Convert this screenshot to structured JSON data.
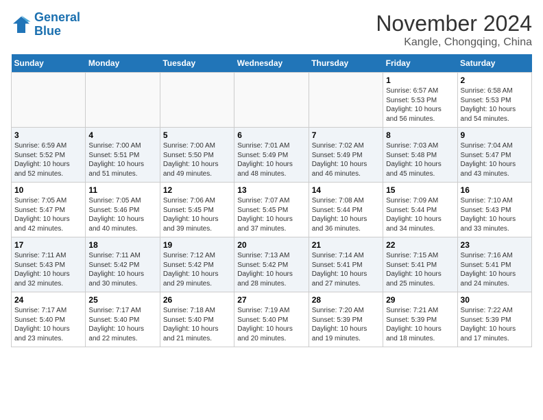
{
  "header": {
    "logo_line1": "General",
    "logo_line2": "Blue",
    "title": "November 2024",
    "subtitle": "Kangle, Chongqing, China"
  },
  "weekdays": [
    "Sunday",
    "Monday",
    "Tuesday",
    "Wednesday",
    "Thursday",
    "Friday",
    "Saturday"
  ],
  "weeks": [
    [
      {
        "num": "",
        "info": ""
      },
      {
        "num": "",
        "info": ""
      },
      {
        "num": "",
        "info": ""
      },
      {
        "num": "",
        "info": ""
      },
      {
        "num": "",
        "info": ""
      },
      {
        "num": "1",
        "info": "Sunrise: 6:57 AM\nSunset: 5:53 PM\nDaylight: 10 hours\nand 56 minutes."
      },
      {
        "num": "2",
        "info": "Sunrise: 6:58 AM\nSunset: 5:53 PM\nDaylight: 10 hours\nand 54 minutes."
      }
    ],
    [
      {
        "num": "3",
        "info": "Sunrise: 6:59 AM\nSunset: 5:52 PM\nDaylight: 10 hours\nand 52 minutes."
      },
      {
        "num": "4",
        "info": "Sunrise: 7:00 AM\nSunset: 5:51 PM\nDaylight: 10 hours\nand 51 minutes."
      },
      {
        "num": "5",
        "info": "Sunrise: 7:00 AM\nSunset: 5:50 PM\nDaylight: 10 hours\nand 49 minutes."
      },
      {
        "num": "6",
        "info": "Sunrise: 7:01 AM\nSunset: 5:49 PM\nDaylight: 10 hours\nand 48 minutes."
      },
      {
        "num": "7",
        "info": "Sunrise: 7:02 AM\nSunset: 5:49 PM\nDaylight: 10 hours\nand 46 minutes."
      },
      {
        "num": "8",
        "info": "Sunrise: 7:03 AM\nSunset: 5:48 PM\nDaylight: 10 hours\nand 45 minutes."
      },
      {
        "num": "9",
        "info": "Sunrise: 7:04 AM\nSunset: 5:47 PM\nDaylight: 10 hours\nand 43 minutes."
      }
    ],
    [
      {
        "num": "10",
        "info": "Sunrise: 7:05 AM\nSunset: 5:47 PM\nDaylight: 10 hours\nand 42 minutes."
      },
      {
        "num": "11",
        "info": "Sunrise: 7:05 AM\nSunset: 5:46 PM\nDaylight: 10 hours\nand 40 minutes."
      },
      {
        "num": "12",
        "info": "Sunrise: 7:06 AM\nSunset: 5:45 PM\nDaylight: 10 hours\nand 39 minutes."
      },
      {
        "num": "13",
        "info": "Sunrise: 7:07 AM\nSunset: 5:45 PM\nDaylight: 10 hours\nand 37 minutes."
      },
      {
        "num": "14",
        "info": "Sunrise: 7:08 AM\nSunset: 5:44 PM\nDaylight: 10 hours\nand 36 minutes."
      },
      {
        "num": "15",
        "info": "Sunrise: 7:09 AM\nSunset: 5:44 PM\nDaylight: 10 hours\nand 34 minutes."
      },
      {
        "num": "16",
        "info": "Sunrise: 7:10 AM\nSunset: 5:43 PM\nDaylight: 10 hours\nand 33 minutes."
      }
    ],
    [
      {
        "num": "17",
        "info": "Sunrise: 7:11 AM\nSunset: 5:43 PM\nDaylight: 10 hours\nand 32 minutes."
      },
      {
        "num": "18",
        "info": "Sunrise: 7:11 AM\nSunset: 5:42 PM\nDaylight: 10 hours\nand 30 minutes."
      },
      {
        "num": "19",
        "info": "Sunrise: 7:12 AM\nSunset: 5:42 PM\nDaylight: 10 hours\nand 29 minutes."
      },
      {
        "num": "20",
        "info": "Sunrise: 7:13 AM\nSunset: 5:42 PM\nDaylight: 10 hours\nand 28 minutes."
      },
      {
        "num": "21",
        "info": "Sunrise: 7:14 AM\nSunset: 5:41 PM\nDaylight: 10 hours\nand 27 minutes."
      },
      {
        "num": "22",
        "info": "Sunrise: 7:15 AM\nSunset: 5:41 PM\nDaylight: 10 hours\nand 25 minutes."
      },
      {
        "num": "23",
        "info": "Sunrise: 7:16 AM\nSunset: 5:41 PM\nDaylight: 10 hours\nand 24 minutes."
      }
    ],
    [
      {
        "num": "24",
        "info": "Sunrise: 7:17 AM\nSunset: 5:40 PM\nDaylight: 10 hours\nand 23 minutes."
      },
      {
        "num": "25",
        "info": "Sunrise: 7:17 AM\nSunset: 5:40 PM\nDaylight: 10 hours\nand 22 minutes."
      },
      {
        "num": "26",
        "info": "Sunrise: 7:18 AM\nSunset: 5:40 PM\nDaylight: 10 hours\nand 21 minutes."
      },
      {
        "num": "27",
        "info": "Sunrise: 7:19 AM\nSunset: 5:40 PM\nDaylight: 10 hours\nand 20 minutes."
      },
      {
        "num": "28",
        "info": "Sunrise: 7:20 AM\nSunset: 5:39 PM\nDaylight: 10 hours\nand 19 minutes."
      },
      {
        "num": "29",
        "info": "Sunrise: 7:21 AM\nSunset: 5:39 PM\nDaylight: 10 hours\nand 18 minutes."
      },
      {
        "num": "30",
        "info": "Sunrise: 7:22 AM\nSunset: 5:39 PM\nDaylight: 10 hours\nand 17 minutes."
      }
    ]
  ]
}
